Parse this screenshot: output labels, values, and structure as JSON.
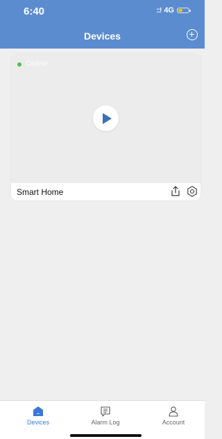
{
  "status_bar": {
    "time": "6:40",
    "signal": "::!",
    "network": "4G",
    "battery_level": 0.4
  },
  "header": {
    "title": "Devices",
    "add_icon": "plus-circle-icon"
  },
  "device_card": {
    "status": "Online",
    "status_color": "#4cc04c",
    "name": "Smart Home",
    "actions": [
      "share-icon",
      "settings-icon"
    ]
  },
  "tab_bar": {
    "items": [
      {
        "label": "Devices",
        "icon": "home-icon",
        "active": true
      },
      {
        "label": "Alarm Log",
        "icon": "message-icon",
        "active": false
      },
      {
        "label": "Account",
        "icon": "user-icon",
        "active": false
      }
    ]
  },
  "colors": {
    "header": "#5b8ccf",
    "accent": "#3b78d8",
    "background": "#efefef"
  }
}
